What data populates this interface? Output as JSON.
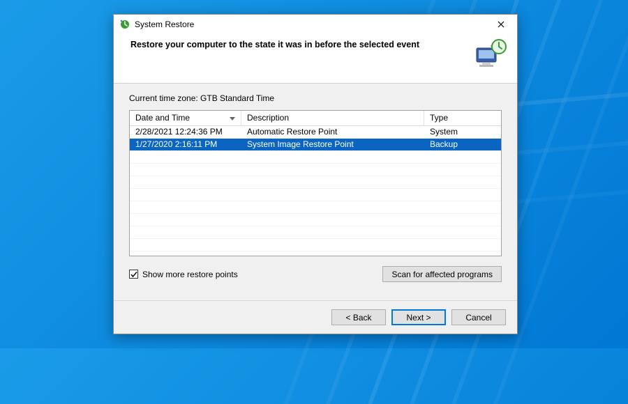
{
  "window": {
    "title": "System Restore"
  },
  "header": {
    "heading": "Restore your computer to the state it was in before the selected event"
  },
  "timezone": {
    "label": "Current time zone: GTB Standard Time"
  },
  "table": {
    "columns": {
      "date": "Date and Time",
      "desc": "Description",
      "type": "Type"
    },
    "rows": [
      {
        "date": "2/28/2021 12:24:36 PM",
        "desc": "Automatic Restore Point",
        "type": "System",
        "selected": false
      },
      {
        "date": "1/27/2020 2:16:11 PM",
        "desc": "System Image Restore Point",
        "type": "Backup",
        "selected": true
      }
    ]
  },
  "controls": {
    "show_more_checkbox_label": "Show more restore points",
    "show_more_checked": true,
    "scan_button": "Scan for affected programs"
  },
  "footer": {
    "back": "< Back",
    "next": "Next >",
    "cancel": "Cancel"
  }
}
